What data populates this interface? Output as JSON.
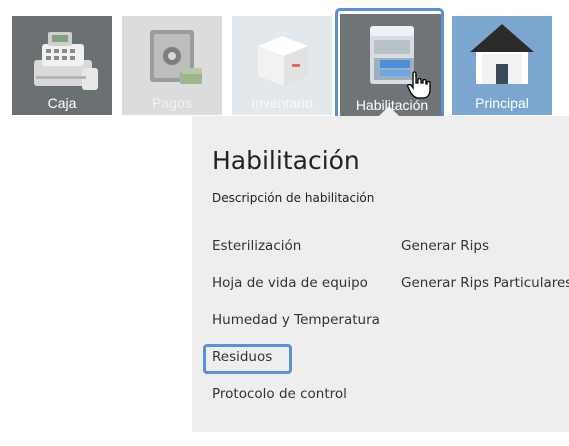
{
  "tiles": [
    {
      "label": "Caja",
      "icon": "cash-register-icon"
    },
    {
      "label": "Pagos",
      "icon": "safe-icon"
    },
    {
      "label": "Inventario",
      "icon": "box-icon"
    },
    {
      "label": "Habilitación",
      "icon": "file-cabinet-icon"
    },
    {
      "label": "Principal",
      "icon": "house-icon"
    }
  ],
  "selected_tile": "Habilitación",
  "panel": {
    "title": "Habilitación",
    "description": "Descripción de habilitación",
    "left_items": [
      "Esterilización",
      "Hoja de vida de equipo",
      "Humedad y Temperatura",
      "Residuos",
      "Protocolo de control"
    ],
    "right_items": [
      "Generar Rips",
      "Generar Rips Particulares"
    ],
    "focused_item": "Residuos"
  },
  "colors": {
    "focus_outline": "#5b8fd6",
    "panel_bg": "#eeeeee",
    "tile_principal": "#7aa6cf",
    "tile_dark": "#6e7478"
  }
}
